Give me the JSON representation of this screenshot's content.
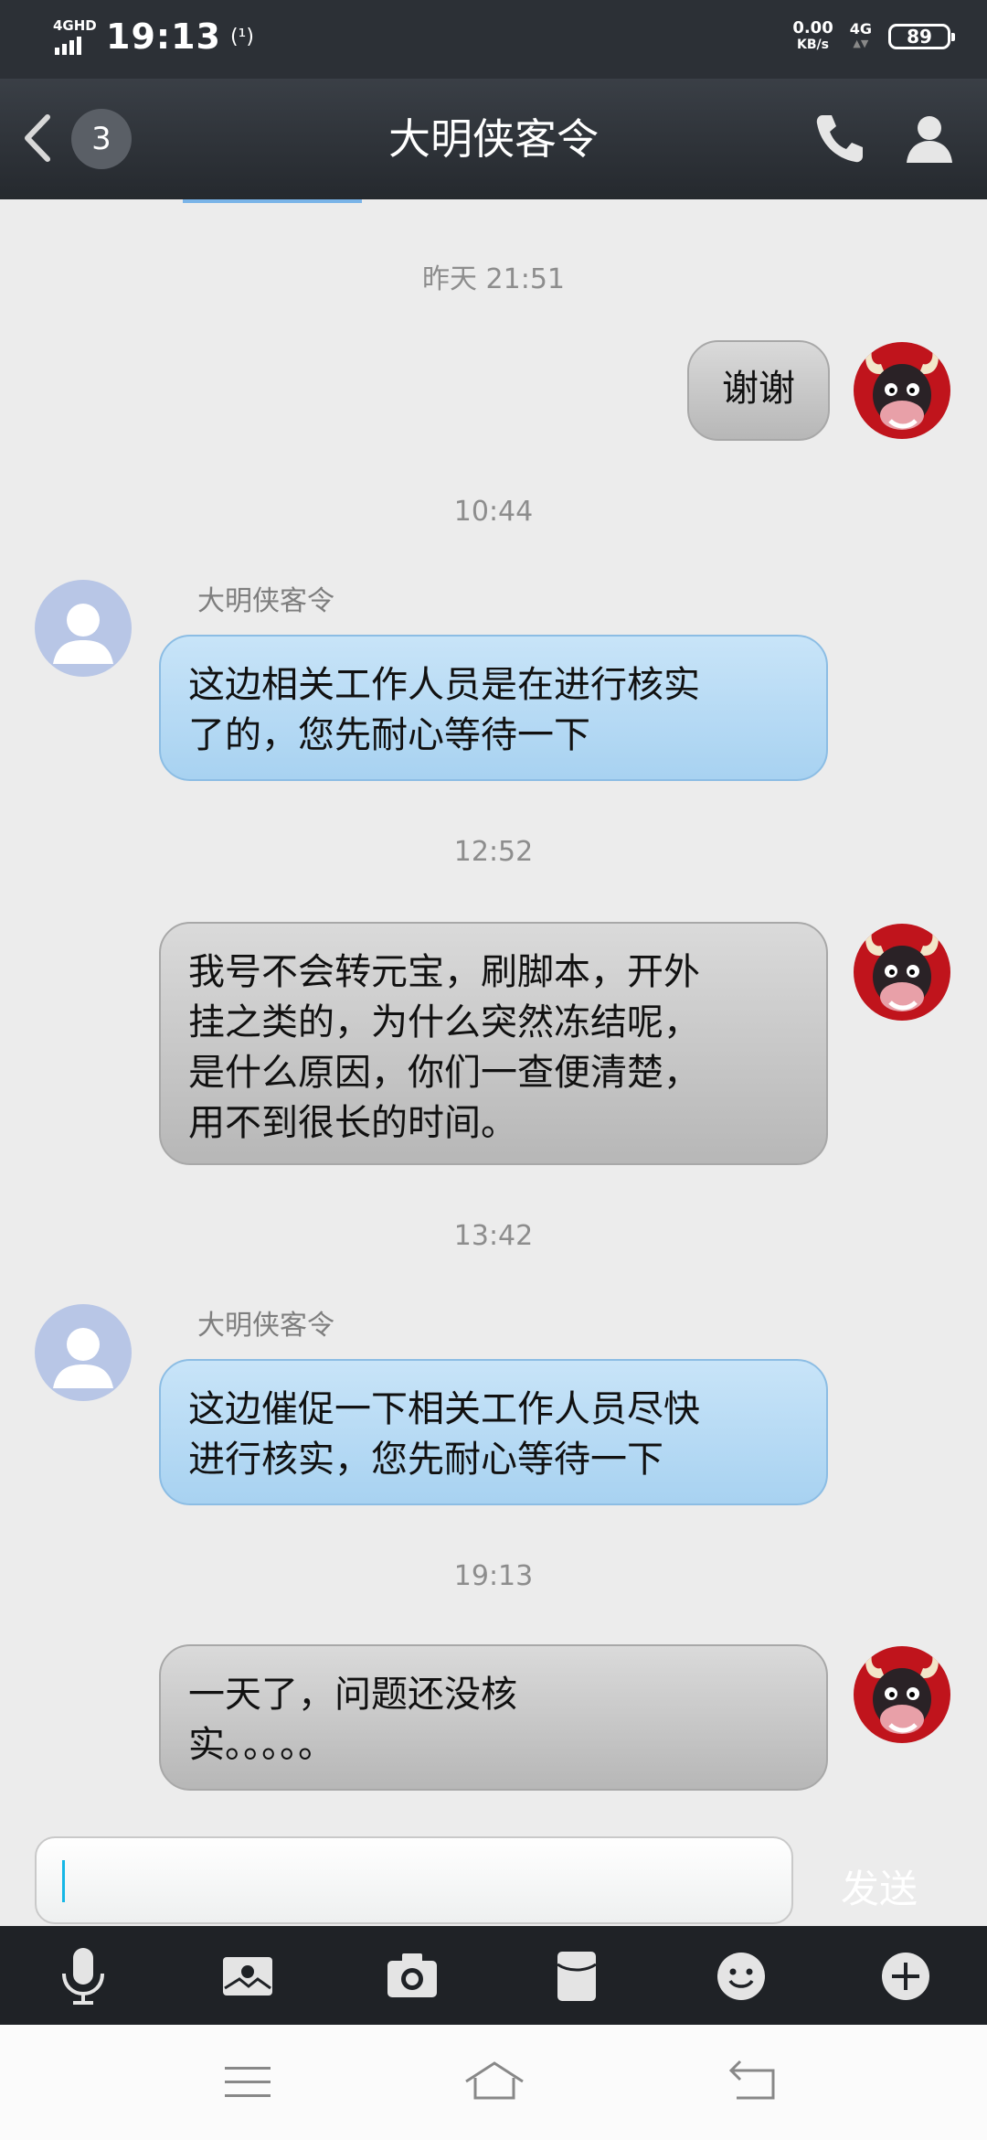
{
  "status_bar": {
    "network": "4GHD",
    "time": "19:13",
    "nfc": "(¹)",
    "speed_value": "0.00",
    "speed_unit": "KB/s",
    "cell": "4G",
    "battery": "89"
  },
  "header": {
    "unread_count": "3",
    "title": "大明侠客令",
    "icons": [
      "back-icon",
      "phone-icon",
      "profile-icon"
    ]
  },
  "messages": [
    {
      "time": "昨天 21:51",
      "from": "me",
      "text": "谢谢"
    },
    {
      "time": "10:44",
      "from": "them",
      "sender": "大明侠客令",
      "lines": [
        "这边相关工作人员是在进行核实",
        "了的，您先耐心等待一下"
      ]
    },
    {
      "time": "12:52",
      "from": "me",
      "lines": [
        "我号不会转元宝，刷脚本，开外",
        "挂之类的，为什么突然冻结呢，",
        "是什么原因，你们一查便清楚，",
        "用不到很长的时间。"
      ]
    },
    {
      "time": "13:42",
      "from": "them",
      "sender": "大明侠客令",
      "lines": [
        "这边催促一下相关工作人员尽快",
        "进行核实，您先耐心等待一下"
      ]
    },
    {
      "time": "19:13",
      "from": "me",
      "lines": [
        "一天了，问题还没核",
        "实。。。。。"
      ]
    }
  ],
  "composer": {
    "input_value": "",
    "send_label": "发送"
  },
  "toolbar_icons": [
    "microphone-icon",
    "image-icon",
    "camera-icon",
    "red-packet-icon",
    "emoji-icon",
    "plus-icon"
  ],
  "nav_icons": [
    "menu-icon",
    "home-icon",
    "back-nav-icon"
  ],
  "colors": {
    "accent_blue": "#a8d2f1",
    "header_bg": "#2c3036",
    "chat_bg": "#ececec"
  }
}
